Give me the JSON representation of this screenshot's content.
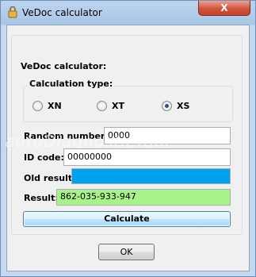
{
  "window": {
    "title": "VeDoc calculator",
    "close_label": "X"
  },
  "group": {
    "label": "VeDoc calculator:"
  },
  "calc_type": {
    "label": "Calculation type:",
    "options": [
      {
        "label": "XN",
        "selected": false
      },
      {
        "label": "XT",
        "selected": false
      },
      {
        "label": "XS",
        "selected": true
      }
    ]
  },
  "fields": {
    "random_number": {
      "label": "Random number:",
      "value": "0000"
    },
    "id_code": {
      "label": "ID code:",
      "value": "00000000"
    },
    "old_result": {
      "label": "Old result:",
      "value": "",
      "color": "#00a2f0"
    },
    "result": {
      "label": "Result:",
      "value": "862-035-933-947",
      "color": "#a8f28a"
    }
  },
  "buttons": {
    "calculate": "Calculate",
    "ok": "OK"
  },
  "watermark": "autoDiagnosticTool"
}
